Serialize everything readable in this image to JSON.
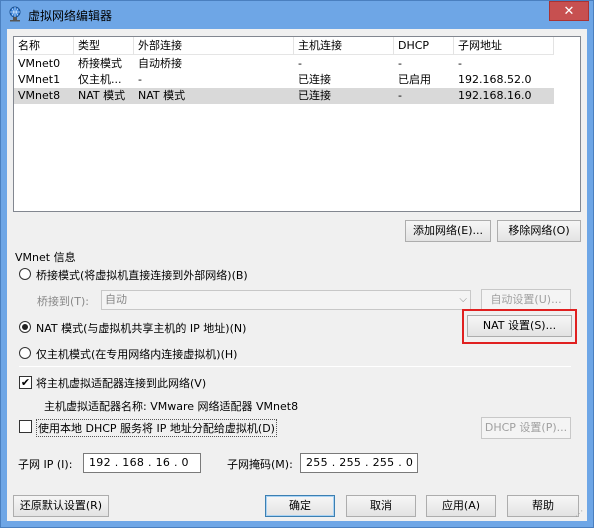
{
  "window": {
    "title": "虚拟网络编辑器",
    "close_label": "✕"
  },
  "network_list": {
    "columns": [
      "名称",
      "类型",
      "外部连接",
      "主机连接",
      "DHCP",
      "子网地址"
    ],
    "rows": [
      {
        "name": "VMnet0",
        "type": "桥接模式",
        "external": "自动桥接",
        "host": "-",
        "dhcp": "-",
        "subnet": "-"
      },
      {
        "name": "VMnet1",
        "type": "仅主机...",
        "external": "-",
        "host": "已连接",
        "dhcp": "已启用",
        "subnet": "192.168.52.0"
      },
      {
        "name": "VMnet8",
        "type": "NAT 模式",
        "external": "NAT 模式",
        "host": "已连接",
        "dhcp": "-",
        "subnet": "192.168.16.0"
      }
    ]
  },
  "list_buttons": {
    "add": "添加网络(E)...",
    "remove": "移除网络(O)"
  },
  "vmnet_info": {
    "group_label": "VMnet 信息",
    "bridged_label": "桥接模式(将虚拟机直接连接到外部网络)(B)",
    "bridged_to_label": "桥接到(T):",
    "bridged_to_value": "自动",
    "auto_settings": "自动设置(U)...",
    "nat_label": "NAT 模式(与虚拟机共享主机的 IP 地址)(N)",
    "nat_settings": "NAT 设置(S)...",
    "hostonly_label": "仅主机模式(在专用网络内连接虚拟机)(H)",
    "connect_adapter_label": "将主机虚拟适配器连接到此网络(V)",
    "adapter_name_label": "主机虚拟适配器名称: VMware 网络适配器 VMnet8",
    "dhcp_label": "使用本地 DHCP 服务将 IP 地址分配给虚拟机(D)",
    "dhcp_settings": "DHCP 设置(P)...",
    "subnet_ip_label": "子网 IP (I):",
    "subnet_ip_value": "192 . 168 . 16 . 0",
    "subnet_mask_label": "子网掩码(M):",
    "subnet_mask_value": "255 . 255 . 255 . 0",
    "mode_selected": "nat",
    "connect_adapter_checked": true,
    "dhcp_checked": false
  },
  "footer": {
    "restore": "还原默认设置(R)",
    "ok": "确定",
    "cancel": "取消",
    "apply": "应用(A)",
    "help": "帮助"
  }
}
